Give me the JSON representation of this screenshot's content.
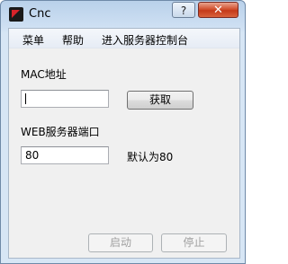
{
  "window": {
    "title": "Cnc",
    "help_label": "?",
    "close_label": "✕"
  },
  "menu": {
    "items": [
      "菜单",
      "帮助",
      "进入服务器控制台"
    ]
  },
  "form": {
    "mac_label": "MAC地址",
    "mac_value": "",
    "get_button": "获取",
    "port_label": "WEB服务器端口",
    "port_value": "80",
    "port_hint": "默认为80"
  },
  "footer": {
    "start_button": "启动",
    "stop_button": "停止"
  }
}
